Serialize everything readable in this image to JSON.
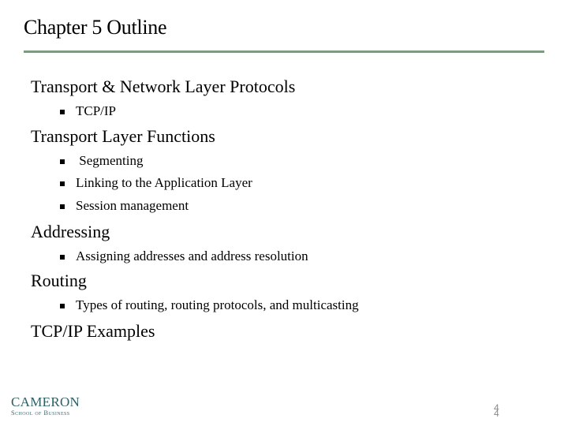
{
  "slide": {
    "title": "Chapter 5 Outline",
    "colors": {
      "title_rule": "#7f9a80",
      "logo": "#2e5f64",
      "page_number": "#8a8a8a"
    },
    "outline": [
      {
        "label": "Transport & Network Layer Protocols",
        "subitems": [
          "TCP/IP"
        ]
      },
      {
        "label": "Transport Layer Functions",
        "subitems": [
          " Segmenting",
          "Linking to the Application Layer",
          "Session management"
        ]
      },
      {
        "label": "Addressing",
        "subitems": [
          "Assigning addresses and address resolution"
        ]
      },
      {
        "label": "Routing",
        "subitems": [
          "Types of routing, routing protocols, and multicasting"
        ]
      },
      {
        "label": "TCP/IP Examples",
        "subitems": []
      }
    ],
    "logo": {
      "name": "CAMERON",
      "subtitle": "School of Business"
    },
    "page_number": "4",
    "bullet_icon": "square-bullet-icon"
  }
}
